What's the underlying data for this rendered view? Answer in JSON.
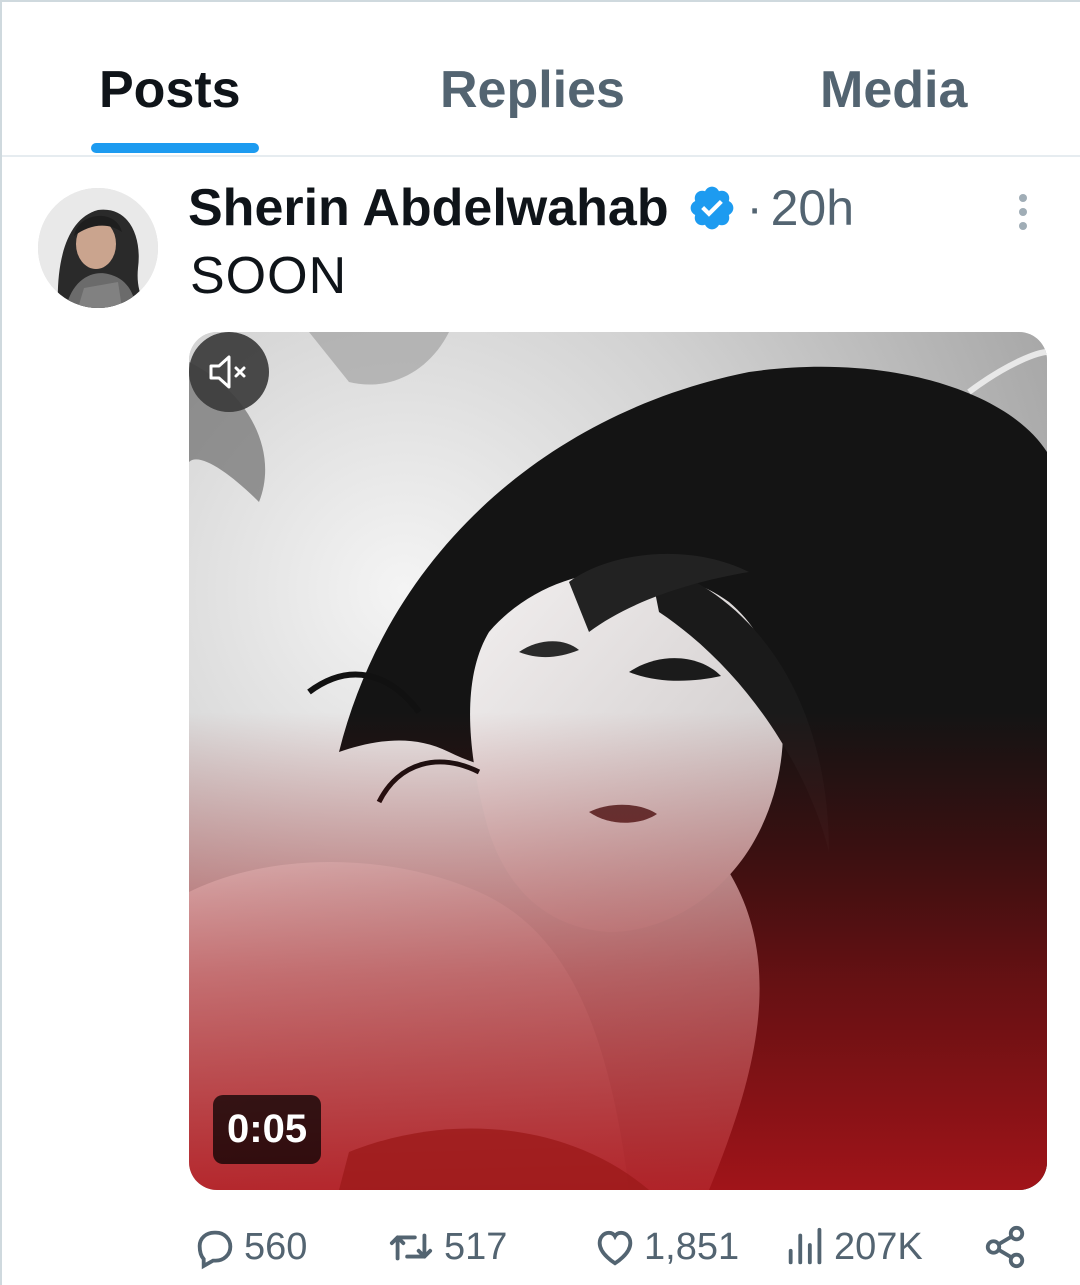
{
  "tabs": [
    {
      "label": "Posts",
      "active": true
    },
    {
      "label": "Replies",
      "active": false
    },
    {
      "label": "Media",
      "active": false
    }
  ],
  "post": {
    "author": "Sherin Abdelwahab",
    "verified": true,
    "separator": "·",
    "time": "20h",
    "text": "SOON",
    "video": {
      "duration": "0:05",
      "muted": true
    },
    "stats": {
      "replies": "560",
      "reposts": "517",
      "likes": "1,851",
      "views": "207K"
    }
  },
  "colors": {
    "accent": "#1d9bf0",
    "text_primary": "#0f1419",
    "text_secondary": "#536471"
  },
  "icons": [
    "verified-badge-icon",
    "more-icon",
    "mute-icon",
    "reply-icon",
    "repost-icon",
    "like-icon",
    "views-icon",
    "share-icon"
  ]
}
